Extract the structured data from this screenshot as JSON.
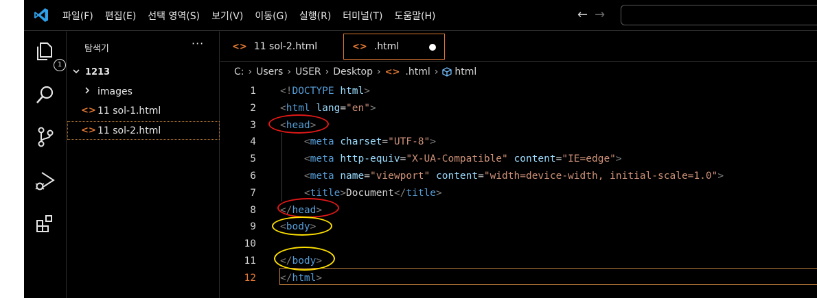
{
  "menu": [
    "파일(F)",
    "편집(E)",
    "선택 영역(S)",
    "보기(V)",
    "이동(G)",
    "실행(R)",
    "터미널(T)",
    "도움말(H)"
  ],
  "nav": {
    "back": "←",
    "forward": "→"
  },
  "activity": {
    "explorer_badge": "1"
  },
  "sidebar": {
    "title": "탐색기",
    "more": "···",
    "folder": "1213",
    "items": [
      {
        "label": "images",
        "kind": "folder"
      },
      {
        "label": "11 sol-1.html",
        "kind": "html"
      },
      {
        "label": "11 sol-2.html",
        "kind": "html",
        "selected": true
      }
    ]
  },
  "tabs": [
    {
      "label": "11 sol-2.html",
      "active": false
    },
    {
      "label": ".html",
      "active": true,
      "dirty": true
    }
  ],
  "breadcrumb": [
    "C:",
    "Users",
    "USER",
    "Desktop",
    ".html",
    "html"
  ],
  "icons": {
    "file": "<>",
    "chevron_right": "›",
    "chevron_down": "v"
  },
  "code": {
    "active_line": "12",
    "lines": [
      {
        "n": "1",
        "parts": [
          [
            "br",
            "<!"
          ],
          [
            "tag",
            "DOCTYPE "
          ],
          [
            "attr",
            "html"
          ],
          [
            "br",
            ">"
          ]
        ]
      },
      {
        "n": "2",
        "parts": [
          [
            "br",
            "<"
          ],
          [
            "tag",
            "html "
          ],
          [
            "attr",
            "lang"
          ],
          [
            "txt",
            "="
          ],
          [
            "str",
            "\"en\""
          ],
          [
            "br",
            ">"
          ]
        ]
      },
      {
        "n": "3",
        "parts": [
          [
            "br",
            "<"
          ],
          [
            "tag",
            "head"
          ],
          [
            "br",
            ">"
          ]
        ]
      },
      {
        "n": "4",
        "parts": [
          [
            "txt",
            "    "
          ],
          [
            "br",
            "<"
          ],
          [
            "tag",
            "meta "
          ],
          [
            "attr",
            "charset"
          ],
          [
            "txt",
            "="
          ],
          [
            "str",
            "\"UTF-8\""
          ],
          [
            "br",
            ">"
          ]
        ]
      },
      {
        "n": "5",
        "parts": [
          [
            "txt",
            "    "
          ],
          [
            "br",
            "<"
          ],
          [
            "tag",
            "meta "
          ],
          [
            "attr",
            "http-equiv"
          ],
          [
            "txt",
            "="
          ],
          [
            "str",
            "\"X-UA-Compatible\""
          ],
          [
            "txt",
            " "
          ],
          [
            "attr",
            "content"
          ],
          [
            "txt",
            "="
          ],
          [
            "str",
            "\"IE=edge\""
          ],
          [
            "br",
            ">"
          ]
        ]
      },
      {
        "n": "6",
        "parts": [
          [
            "txt",
            "    "
          ],
          [
            "br",
            "<"
          ],
          [
            "tag",
            "meta "
          ],
          [
            "attr",
            "name"
          ],
          [
            "txt",
            "="
          ],
          [
            "str",
            "\"viewport\""
          ],
          [
            "txt",
            " "
          ],
          [
            "attr",
            "content"
          ],
          [
            "txt",
            "="
          ],
          [
            "str",
            "\"width=device-width, initial-scale=1.0\""
          ],
          [
            "br",
            ">"
          ]
        ]
      },
      {
        "n": "7",
        "parts": [
          [
            "txt",
            "    "
          ],
          [
            "br",
            "<"
          ],
          [
            "tag",
            "title"
          ],
          [
            "br",
            ">"
          ],
          [
            "txt",
            "Document"
          ],
          [
            "br",
            "</"
          ],
          [
            "tag",
            "title"
          ],
          [
            "br",
            ">"
          ]
        ]
      },
      {
        "n": "8",
        "parts": [
          [
            "br",
            "</"
          ],
          [
            "tag",
            "head"
          ],
          [
            "br",
            ">"
          ]
        ]
      },
      {
        "n": "9",
        "parts": [
          [
            "br",
            "<"
          ],
          [
            "tag",
            "body"
          ],
          [
            "br",
            ">"
          ]
        ]
      },
      {
        "n": "10",
        "parts": []
      },
      {
        "n": "11",
        "parts": [
          [
            "br",
            "</"
          ],
          [
            "tag",
            "body"
          ],
          [
            "br",
            ">"
          ]
        ]
      },
      {
        "n": "12",
        "parts": [
          [
            "br",
            "</"
          ],
          [
            "tag",
            "html"
          ],
          [
            "br",
            ">"
          ]
        ]
      }
    ]
  },
  "colors": {
    "accent": "#e37933",
    "highlight_red": "#e01818",
    "highlight_yellow": "#ffe000"
  }
}
